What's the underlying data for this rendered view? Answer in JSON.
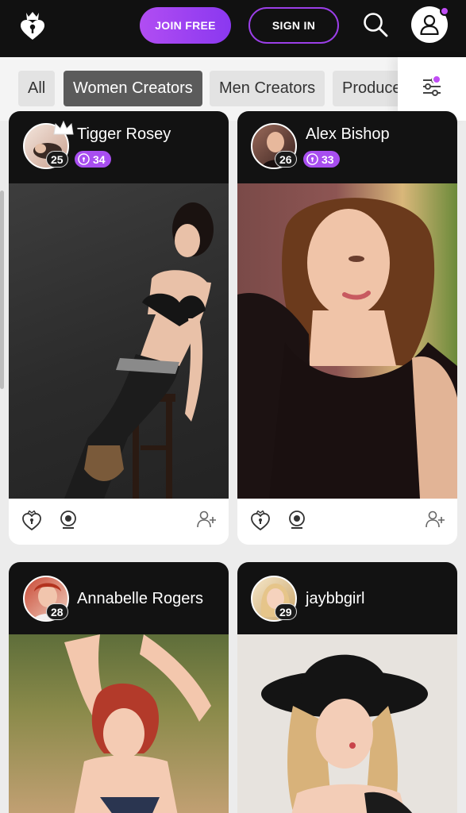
{
  "header": {
    "logo": "crown-heart-logo",
    "join_label": "JOIN FREE",
    "signin_label": "SIGN IN",
    "search_icon": "search-icon",
    "account_icon": "user-icon",
    "colors": {
      "bar": "#111111",
      "accent": "#a84ef0"
    }
  },
  "filters": {
    "chips": [
      "All",
      "Women Creators",
      "Men Creators",
      "Produce"
    ],
    "active": "Women Creators",
    "filter_icon": "sliders-icon"
  },
  "creators": [
    {
      "name": "Tigger Rosey",
      "age": "25",
      "points": "34",
      "crown": true
    },
    {
      "name": "Alex Bishop",
      "age": "26",
      "points": "33",
      "crown": false
    },
    {
      "name": "Annabelle Rogers",
      "age": "28",
      "points": null,
      "crown": false
    },
    {
      "name": "jaybbgirl",
      "age": "29",
      "points": null,
      "crown": false
    }
  ],
  "card_actions": [
    "heart-lock-icon",
    "webcam-icon",
    "add-user-icon"
  ]
}
